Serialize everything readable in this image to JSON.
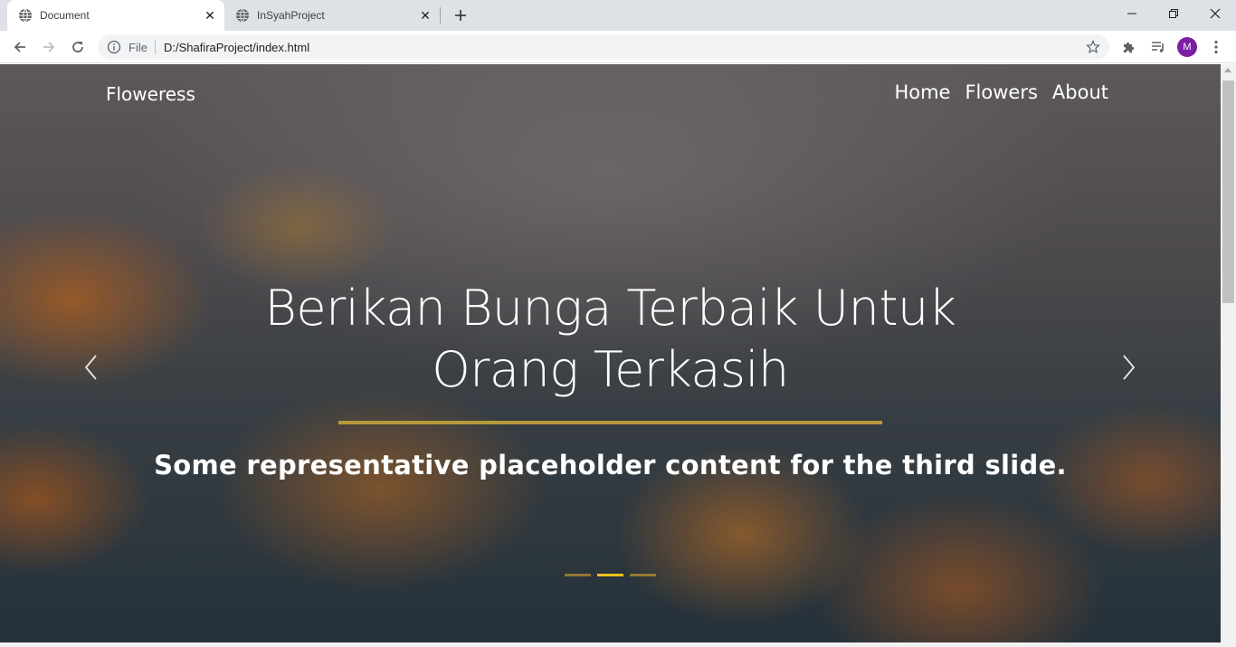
{
  "browser": {
    "tabs": [
      {
        "title": "Document",
        "active": true
      },
      {
        "title": "InSyahProject",
        "active": false
      }
    ],
    "address": {
      "scheme_label": "File",
      "url": "D:/ShafiraProject/index.html"
    },
    "profile_initial": "M"
  },
  "page": {
    "brand": "Floweress",
    "nav": [
      "Home",
      "Flowers",
      "About"
    ],
    "carousel": {
      "heading": "Berikan Bunga Terbaik Untuk Orang Terkasih",
      "caption": "Some representative placeholder content for the third slide.",
      "slide_count": 3,
      "active_index": 1
    }
  },
  "colors": {
    "indicator": "#c1952f",
    "indicator_active": "#f2c01e",
    "divider": "#b69a3a",
    "avatar": "#7b1fa2"
  }
}
